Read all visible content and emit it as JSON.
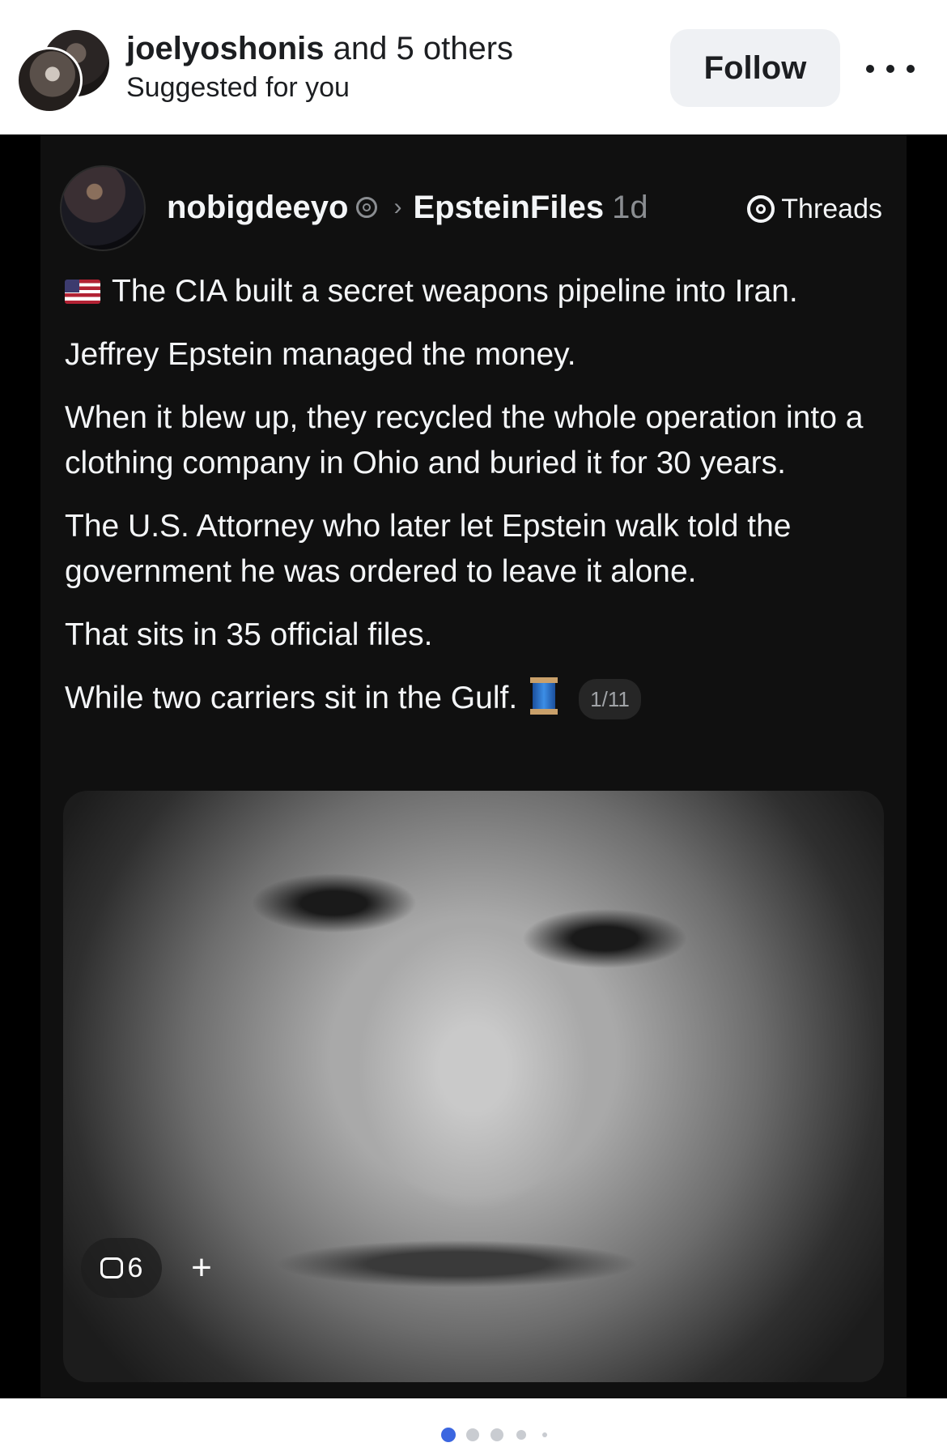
{
  "header": {
    "username": "joelyoshonis",
    "others": "and 5 others",
    "subtitle": "Suggested for you",
    "follow_label": "Follow",
    "more_icon": "more-horizontal-icon"
  },
  "post": {
    "user": "nobigdeeyo",
    "community": "EpsteinFiles",
    "time": "1d",
    "brand": "Threads",
    "paragraphs": [
      "The CIA built a secret weapons pipeline into Iran.",
      "Jeffrey Epstein managed the money.",
      "When it blew up, they recycled the whole operation into a clothing company in Ohio and buried it for 30 years.",
      "The U.S. Attorney who later let Epstein walk told the government he was ordered to leave it alone.",
      "That sits in 35 official files.",
      "While two carriers sit in the Gulf."
    ],
    "page_badge": "1/11",
    "repost_count": "6",
    "plus_label": "+"
  },
  "carousel": {
    "active_index": 0,
    "accent": "#3b66e0"
  }
}
